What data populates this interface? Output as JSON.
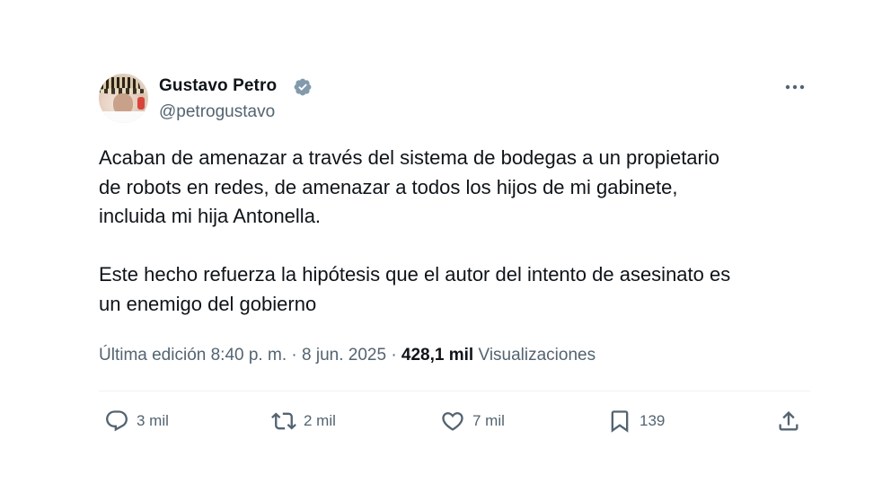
{
  "author": {
    "name": "Gustavo Petro",
    "handle": "@petrogustavo",
    "verified_icon": "verified-badge-icon",
    "avatar_icon": "profile-photo"
  },
  "tweet": {
    "paragraphs": [
      [
        "Acaban de amenazar a través del sistema de bodegas a un propietario",
        "de robots en redes, de amenazar a todos los hijos de mi gabinete,",
        "incluida mi hija Antonella."
      ],
      [
        "Este hecho refuerza la hipótesis que el autor del intento de asesinato es",
        "un enemigo del gobierno"
      ]
    ]
  },
  "meta": {
    "edited_label": "Última edición",
    "time": "8:40 p. m.",
    "separator": "·",
    "date": "8 jun. 2025",
    "views_count": "428,1 mil",
    "views_label": "Visualizaciones"
  },
  "actions": {
    "reply": {
      "count": "3 mil",
      "icon": "reply-icon"
    },
    "retweet": {
      "count": "2 mil",
      "icon": "retweet-icon"
    },
    "like": {
      "count": "7 mil",
      "icon": "heart-icon"
    },
    "bookmark": {
      "count": "139",
      "icon": "bookmark-icon"
    },
    "share": {
      "icon": "share-icon"
    }
  },
  "colors": {
    "text": "#0f1419",
    "secondary": "#536471",
    "verified": "#829aab",
    "divider": "#eff3f4"
  }
}
